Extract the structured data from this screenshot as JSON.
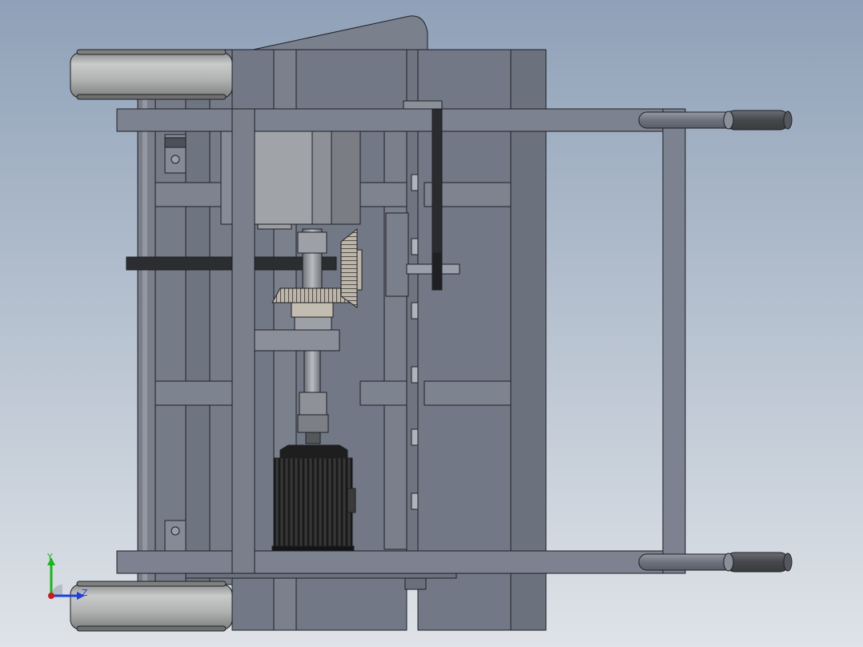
{
  "viewport": {
    "background_top": "#8fa1b8",
    "background_bottom": "#dfe3e8"
  },
  "colors": {
    "frame": "#737886",
    "frame_light": "#818796",
    "frame_dark": "#5d626e",
    "outline": "#1d1f24",
    "wheel": "#b4b6b6",
    "wheel_dark": "#8e9090",
    "motor_body": "#9ea1a6",
    "motor_side": "#7d8087",
    "electric_motor": "#262626",
    "handle": "#777b86",
    "gear": "#b9b1a6",
    "belt": "#2a2b2f",
    "clamp_bar": "#2c2d30"
  },
  "triad": {
    "y_label": "Y",
    "z_label": "Z",
    "y_color": "#1fb21f",
    "z_color": "#1f3fd8",
    "x_color": "#cc1b1b"
  }
}
